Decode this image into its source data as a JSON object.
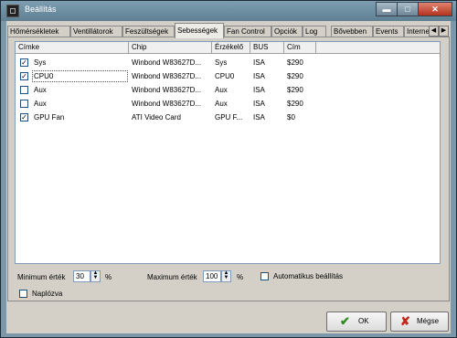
{
  "window": {
    "title": "Beállítás"
  },
  "title_buttons": {
    "minimize": "▬",
    "maximize": "□",
    "close": "✕"
  },
  "tabs": [
    {
      "label": "Hőmérsékletek"
    },
    {
      "label": "Ventillátorok"
    },
    {
      "label": "Feszültségek"
    },
    {
      "label": "Sebességek"
    },
    {
      "label": "Fan Control"
    },
    {
      "label": "Opciók"
    },
    {
      "label": "Log"
    },
    {
      "label": "Bővebben"
    },
    {
      "label": "Events"
    },
    {
      "label": "Interne"
    }
  ],
  "active_tab": "Sebességek",
  "tab_scroll": {
    "left": "◀",
    "right": "▶"
  },
  "table": {
    "columns": [
      "Címke",
      "Chip",
      "Érzékelő",
      "BUS",
      "Cím"
    ],
    "rows": [
      {
        "checked": true,
        "label": "Sys",
        "chip": "Winbond W83627D...",
        "sensor": "Sys",
        "bus": "ISA",
        "address": "$290"
      },
      {
        "checked": true,
        "label": "CPU0",
        "chip": "Winbond W83627D...",
        "sensor": "CPU0",
        "bus": "ISA",
        "address": "$290"
      },
      {
        "checked": false,
        "label": "Aux",
        "chip": "Winbond W83627D...",
        "sensor": "Aux",
        "bus": "ISA",
        "address": "$290"
      },
      {
        "checked": false,
        "label": "Aux",
        "chip": "Winbond W83627D...",
        "sensor": "Aux",
        "bus": "ISA",
        "address": "$290"
      },
      {
        "checked": true,
        "label": "GPU Fan",
        "chip": "ATI Video Card",
        "sensor": "GPU F...",
        "bus": "ISA",
        "address": "$0"
      }
    ]
  },
  "settings": {
    "min_label": "Minimum érték",
    "min_value": "30",
    "min_unit": "%",
    "max_label": "Maximum érték",
    "max_value": "100",
    "max_unit": "%",
    "auto_label": "Automatikus beállítás",
    "auto_checked": false,
    "log_label": "Naplózva",
    "log_checked": false
  },
  "buttons": {
    "ok": "OK",
    "cancel": "Mégse"
  },
  "colors": {
    "ok_icon": "#2e8b1f",
    "cancel_icon": "#c0281a"
  }
}
